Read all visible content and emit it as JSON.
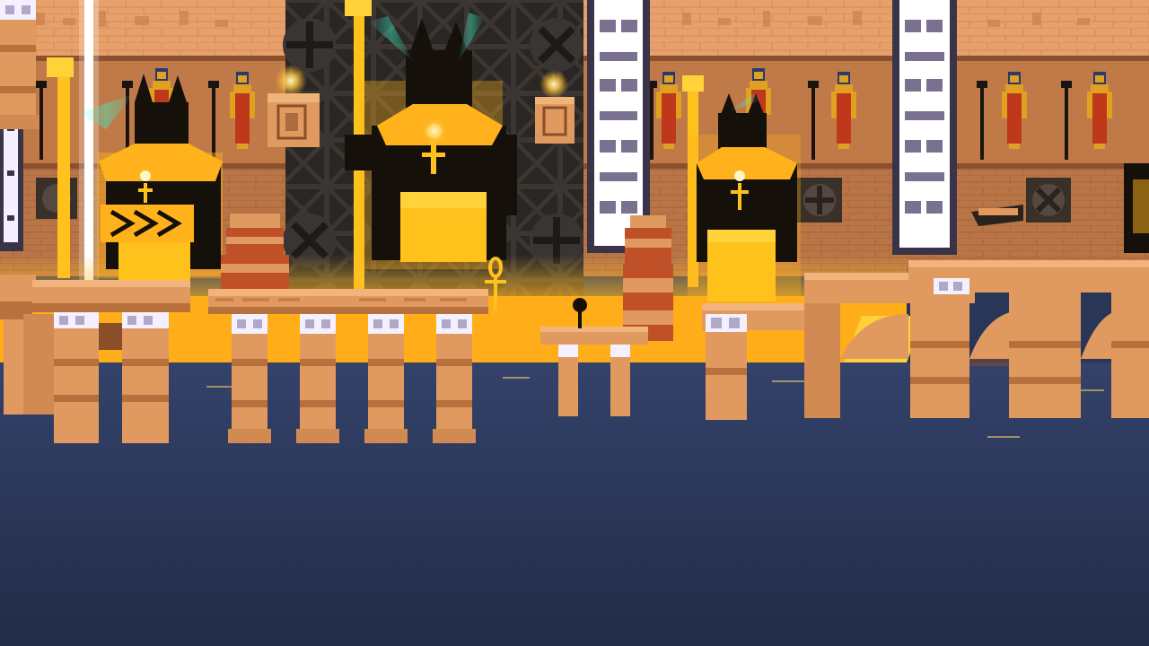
{
  "scene": {
    "palette": {
      "wall_upper": "#e8a06a",
      "wall_lower": "#c8855a",
      "brick_line": "#a8683e",
      "band": "#b06a3a",
      "glow": "#ffb21c",
      "glow_hot": "#ffd23a",
      "statue": "#16100a",
      "stone": "#e09a60",
      "stone_dark": "#b8703c",
      "stone_shadow": "#8a4e28",
      "water": "#2c3a5e",
      "water_dark": "#222c48",
      "light_panel": "#f4f0ff",
      "pillar_frame": "#3a3448",
      "figure_red": "#c0381c",
      "figure_gold": "#e0a020",
      "figure_blue": "#2a3a6a",
      "scaffold": "#2a2624"
    },
    "objects": [
      {
        "kind": "wall-panel",
        "name": "wall-panel-left"
      },
      {
        "kind": "wall-panel",
        "name": "wall-panel-right"
      },
      {
        "kind": "scaffold-tower",
        "name": "scaffold-tower-center"
      },
      {
        "kind": "anubis-statue",
        "name": "anubis-statue-left"
      },
      {
        "kind": "anubis-statue",
        "name": "anubis-statue-center"
      },
      {
        "kind": "anubis-statue",
        "name": "anubis-statue-right"
      },
      {
        "kind": "light-pillar",
        "name": "light-pillar-left"
      },
      {
        "kind": "light-pillar",
        "name": "light-pillar-center"
      },
      {
        "kind": "light-pillar",
        "name": "light-pillar-right"
      },
      {
        "kind": "canopic-jar",
        "name": "canopic-jar-left"
      },
      {
        "kind": "canopic-jar",
        "name": "canopic-jar-center"
      },
      {
        "kind": "hanging-lantern",
        "name": "hanging-lantern-left"
      },
      {
        "kind": "hanging-lantern",
        "name": "hanging-lantern-right"
      },
      {
        "kind": "stone-bridge",
        "name": "stone-bridge-left"
      },
      {
        "kind": "stone-bridge",
        "name": "stone-bridge-center"
      },
      {
        "kind": "stone-bridge",
        "name": "stone-bridge-small"
      },
      {
        "kind": "stone-bridge",
        "name": "stone-bridge-right"
      },
      {
        "kind": "water",
        "name": "water-surface"
      }
    ]
  }
}
